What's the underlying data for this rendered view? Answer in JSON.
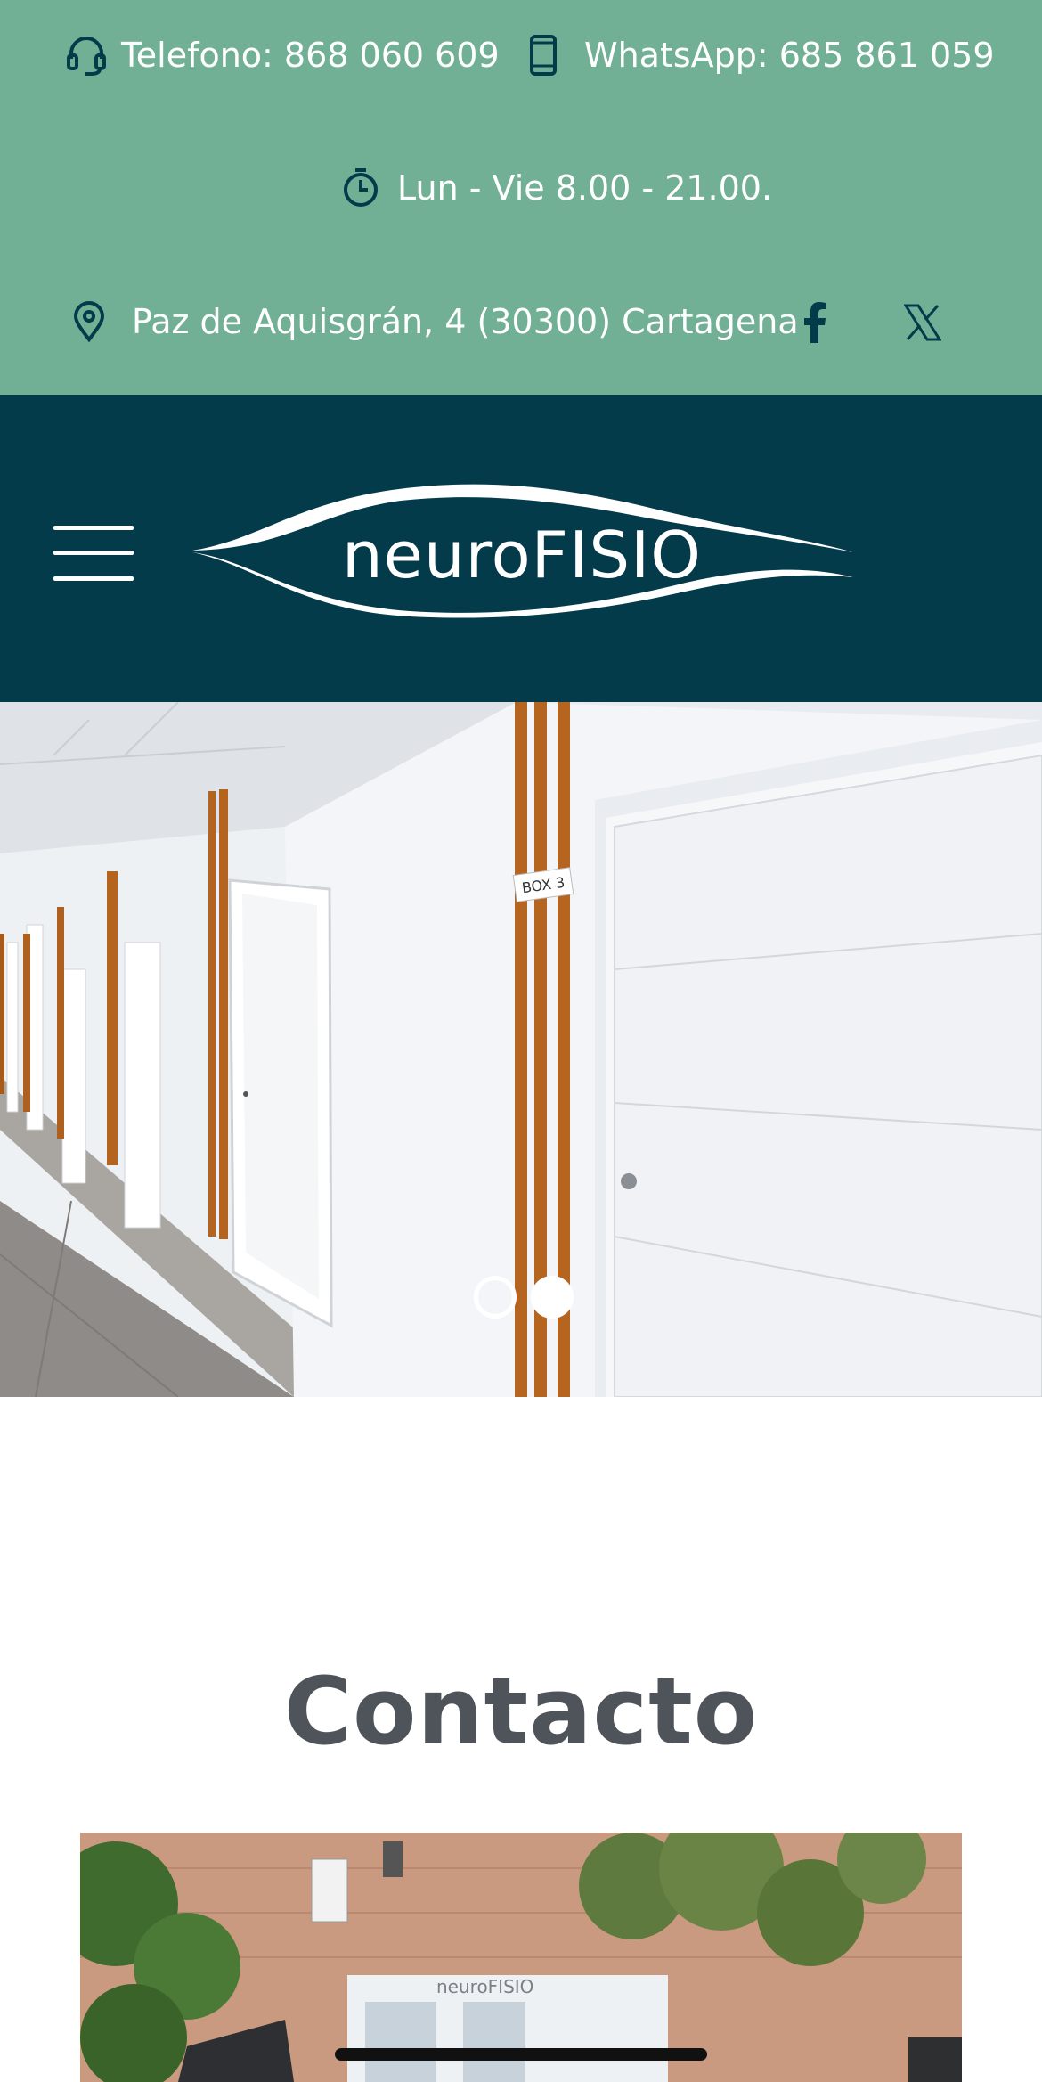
{
  "topbar": {
    "phone": "Telefono: 868 060 609",
    "whatsapp": "WhatsApp: 685 861 059",
    "hours": "Lun - Vie 8.00 - 21.00.",
    "address": "Paz de Aquisgrán, 4 (30300) Cartagena",
    "background": "#72b096",
    "icon_color": "#043b4b",
    "icons": [
      "headset-icon",
      "mobile-phone-icon",
      "clock-icon",
      "map-pin-icon",
      "facebook-icon",
      "x-twitter-icon"
    ]
  },
  "header": {
    "logo_text": "neuroFISIO",
    "background": "#043b4b",
    "icons": [
      "hamburger-menu-icon"
    ]
  },
  "hero": {
    "sign_text": "BOX 3",
    "slides": 2,
    "active_slide": 2
  },
  "contact": {
    "title": "Contacto",
    "photo_logo_text": "neuroFISIO",
    "title_color": "#4f545b"
  }
}
